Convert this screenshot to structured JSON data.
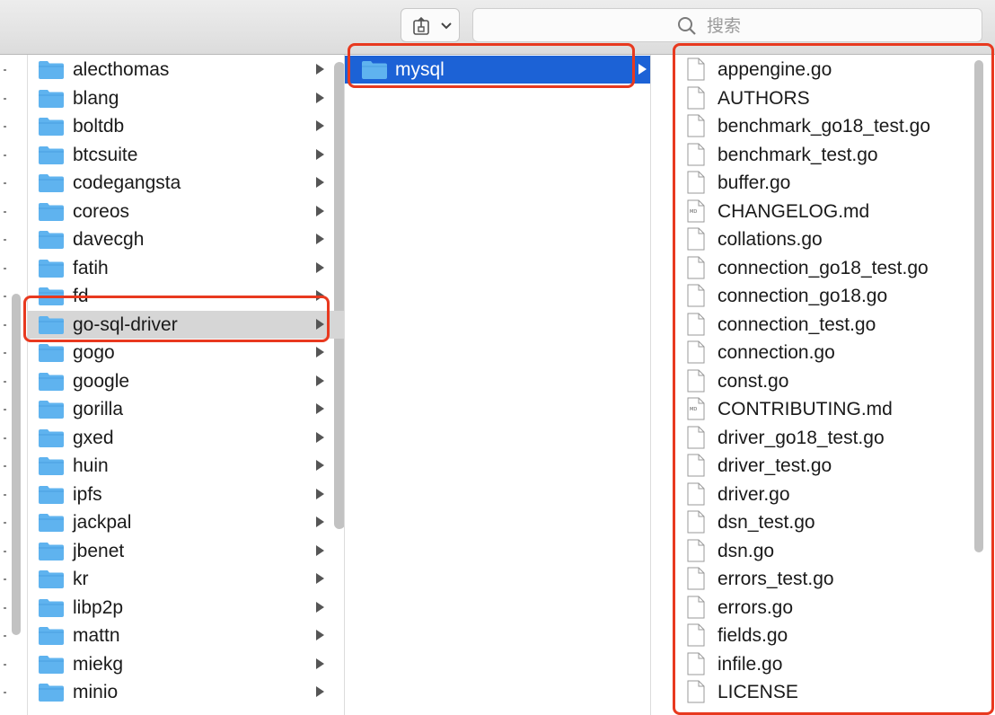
{
  "toolbar": {
    "share_icon": "share-icon",
    "search": {
      "placeholder": "搜索",
      "icon": "search-icon"
    }
  },
  "column_parent": {
    "items": [
      {
        "label": "alecthomas"
      },
      {
        "label": "blang"
      },
      {
        "label": "boltdb"
      },
      {
        "label": "btcsuite"
      },
      {
        "label": "codegangsta"
      },
      {
        "label": "coreos"
      },
      {
        "label": "davecgh"
      },
      {
        "label": "fatih"
      },
      {
        "label": "fd"
      },
      {
        "label": "go-sql-driver"
      },
      {
        "label": "gogo"
      },
      {
        "label": "google"
      },
      {
        "label": "gorilla"
      },
      {
        "label": "gxed"
      },
      {
        "label": "huin"
      },
      {
        "label": "ipfs"
      },
      {
        "label": "jackpal"
      },
      {
        "label": "jbenet"
      },
      {
        "label": "kr"
      },
      {
        "label": "libp2p"
      },
      {
        "label": "mattn"
      },
      {
        "label": "miekg"
      },
      {
        "label": "minio"
      }
    ],
    "selected": "go-sql-driver"
  },
  "column_sub": {
    "items": [
      {
        "label": "mysql"
      }
    ],
    "selected": "mysql"
  },
  "column_files": {
    "items": [
      {
        "label": "appengine.go",
        "kind": "doc"
      },
      {
        "label": "AUTHORS",
        "kind": "doc"
      },
      {
        "label": "benchmark_go18_test.go",
        "kind": "doc"
      },
      {
        "label": "benchmark_test.go",
        "kind": "doc"
      },
      {
        "label": "buffer.go",
        "kind": "doc"
      },
      {
        "label": "CHANGELOG.md",
        "kind": "md"
      },
      {
        "label": "collations.go",
        "kind": "doc"
      },
      {
        "label": "connection_go18_test.go",
        "kind": "doc"
      },
      {
        "label": "connection_go18.go",
        "kind": "doc"
      },
      {
        "label": "connection_test.go",
        "kind": "doc"
      },
      {
        "label": "connection.go",
        "kind": "doc"
      },
      {
        "label": "const.go",
        "kind": "doc"
      },
      {
        "label": "CONTRIBUTING.md",
        "kind": "md"
      },
      {
        "label": "driver_go18_test.go",
        "kind": "doc"
      },
      {
        "label": "driver_test.go",
        "kind": "doc"
      },
      {
        "label": "driver.go",
        "kind": "doc"
      },
      {
        "label": "dsn_test.go",
        "kind": "doc"
      },
      {
        "label": "dsn.go",
        "kind": "doc"
      },
      {
        "label": "errors_test.go",
        "kind": "doc"
      },
      {
        "label": "errors.go",
        "kind": "doc"
      },
      {
        "label": "fields.go",
        "kind": "doc"
      },
      {
        "label": "infile.go",
        "kind": "doc"
      },
      {
        "label": "LICENSE",
        "kind": "doc"
      }
    ]
  },
  "colors": {
    "folder": "#5fb3ef",
    "selection": "#1c62d6",
    "highlight": "#d6d6d6",
    "annotation": "#e8391f"
  }
}
